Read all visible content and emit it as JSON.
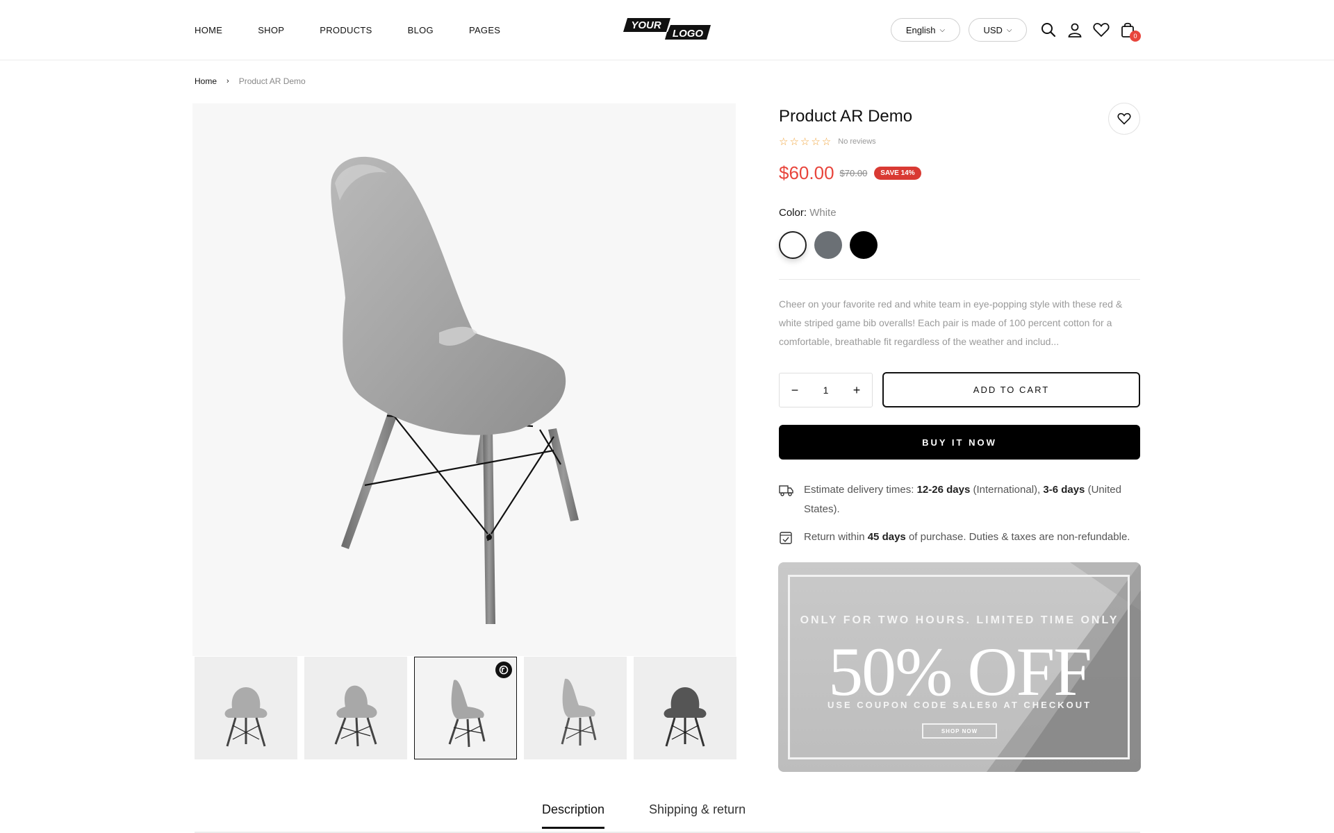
{
  "header": {
    "nav": [
      "HOME",
      "SHOP",
      "PRODUCTS",
      "BLOG",
      "PAGES"
    ],
    "logo": {
      "top": "YOUR",
      "bottom": "LOGO"
    },
    "language": "English",
    "currency": "USD",
    "cart_count": "0",
    "icons": [
      "search-icon",
      "account-icon",
      "wishlist-icon",
      "cart-icon"
    ]
  },
  "breadcrumb": {
    "home": "Home",
    "separator": "›",
    "current": "Product AR Demo"
  },
  "product": {
    "title": "Product AR Demo",
    "stars": "☆☆☆☆☆",
    "reviews": "No reviews",
    "price": "$60.00",
    "compare_price": "$70.00",
    "save_badge": "SAVE 14%",
    "color_label": "Color:",
    "color_value": "White",
    "swatches": [
      "White",
      "Grey",
      "Black"
    ],
    "description": "Cheer on your favorite red and white team in eye-popping style with these red & white striped game bib overalls! Each pair is made of 100 percent cotton for a comfortable, breathable fit regardless of the weather and includ...",
    "quantity": "1",
    "add_to_cart": "ADD TO CART",
    "buy_now": "BUY IT NOW",
    "accent_color": "#e8453c"
  },
  "delivery": {
    "prefix": "Estimate delivery times:",
    "intl_days": "12-26 days",
    "intl_label": "(International),",
    "us_days": "3-6 days",
    "us_label": "(United States)."
  },
  "returns": {
    "prefix": "Return within",
    "days": "45 days",
    "suffix": "of purchase. Duties & taxes are non-refundable."
  },
  "banner": {
    "subtitle": "ONLY FOR TWO HOURS. LIMITED TIME ONLY",
    "headline": "50% OFF",
    "coupon": "USE COUPON CODE SALE50 AT CHECKOUT",
    "button": "SHOP NOW"
  },
  "tabs": [
    "Description",
    "Shipping & return"
  ]
}
